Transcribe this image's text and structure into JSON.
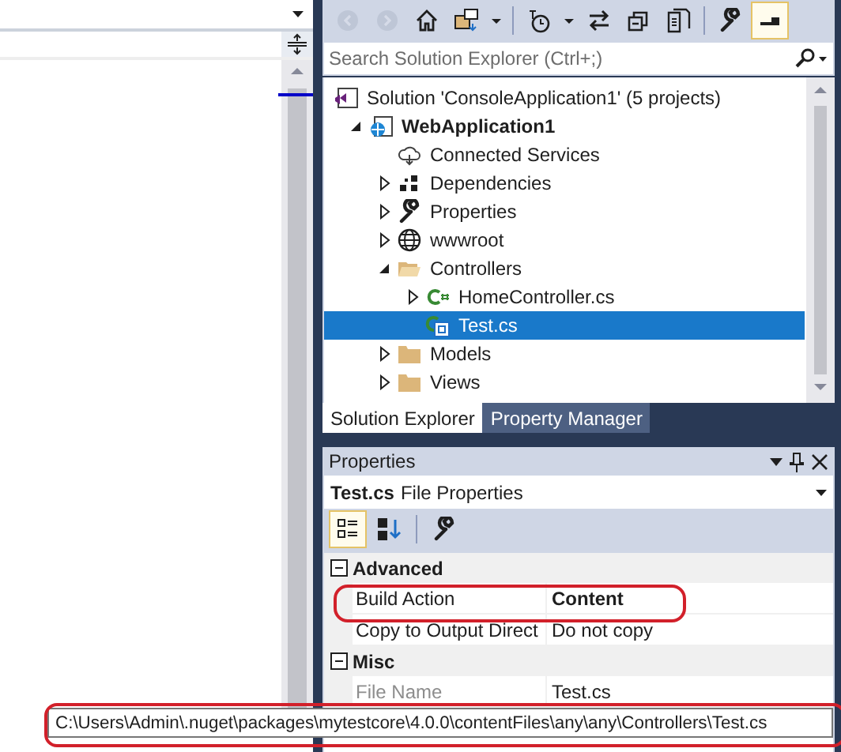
{
  "toolbar": {
    "items": [
      {
        "kind": "back",
        "disabled": true
      },
      {
        "kind": "forward",
        "disabled": true
      },
      {
        "kind": "home",
        "disabled": false
      },
      {
        "kind": "sync",
        "disabled": false
      },
      {
        "kind": "caret",
        "disabled": false
      },
      {
        "kind": "history",
        "disabled": false
      },
      {
        "kind": "caret",
        "disabled": false
      },
      {
        "kind": "swap",
        "disabled": false
      },
      {
        "kind": "collapse",
        "disabled": false
      },
      {
        "kind": "files",
        "disabled": false
      },
      {
        "kind": "wrench",
        "disabled": false
      },
      {
        "kind": "preview",
        "disabled": false,
        "selected": true
      }
    ]
  },
  "search": {
    "placeholder": "Search Solution Explorer (Ctrl+;)"
  },
  "tree": [
    {
      "kind": "solution",
      "label": "Solution 'ConsoleApplication1' (5 projects)",
      "selected": false,
      "children": [
        {
          "kind": "project",
          "label": "WebApplication1",
          "expanded": true,
          "selected": false,
          "children": [
            {
              "kind": "service",
              "label": "Connected Services",
              "selected": false
            },
            {
              "kind": "dependencies",
              "label": "Dependencies",
              "expanded": false,
              "selected": false
            },
            {
              "kind": "properties",
              "label": "Properties",
              "expanded": false,
              "selected": false
            },
            {
              "kind": "globe",
              "label": "wwwroot",
              "expanded": false,
              "selected": false
            },
            {
              "kind": "folder-open",
              "label": "Controllers",
              "expanded": true,
              "selected": false,
              "children": [
                {
                  "kind": "csharp",
                  "label": "HomeController.cs",
                  "expanded": false,
                  "selected": false
                },
                {
                  "kind": "csharp-file",
                  "label": "Test.cs",
                  "selected": true
                }
              ]
            },
            {
              "kind": "folder",
              "label": "Models",
              "expanded": false,
              "selected": false
            },
            {
              "kind": "folder",
              "label": "Views",
              "expanded": false,
              "selected": false
            }
          ]
        }
      ]
    }
  ],
  "tabs": [
    {
      "label": "Solution Explorer",
      "selected": true
    },
    {
      "label": "Property Manager",
      "selected": false
    }
  ],
  "properties": {
    "title": "Properties",
    "object_name": "Test.cs",
    "object_type": "File Properties",
    "toolbar": [
      {
        "kind": "categorized",
        "selected": true
      },
      {
        "kind": "alphabetical",
        "selected": false
      },
      {
        "kind": "wrench",
        "selected": false
      }
    ],
    "categories": [
      {
        "name": "Advanced",
        "expanded": true,
        "rows": [
          {
            "name": "Build Action",
            "value": "Content",
            "value_bold": true,
            "disabled": false,
            "highlighted": true
          },
          {
            "name": "Copy to Output Direct",
            "value": "Do not copy",
            "value_bold": false,
            "disabled": false,
            "highlighted": false
          }
        ]
      },
      {
        "name": "Misc",
        "expanded": true,
        "rows": [
          {
            "name": "File Name",
            "value": "Test.cs",
            "value_bold": false,
            "disabled": true,
            "highlighted": false
          }
        ]
      }
    ]
  },
  "tooltip": {
    "text": "C:\\Users\\Admin\\.nuget\\packages\\mytestcore\\4.0.0\\contentFiles\\any\\any\\Controllers\\Test.cs",
    "highlighted": true
  }
}
